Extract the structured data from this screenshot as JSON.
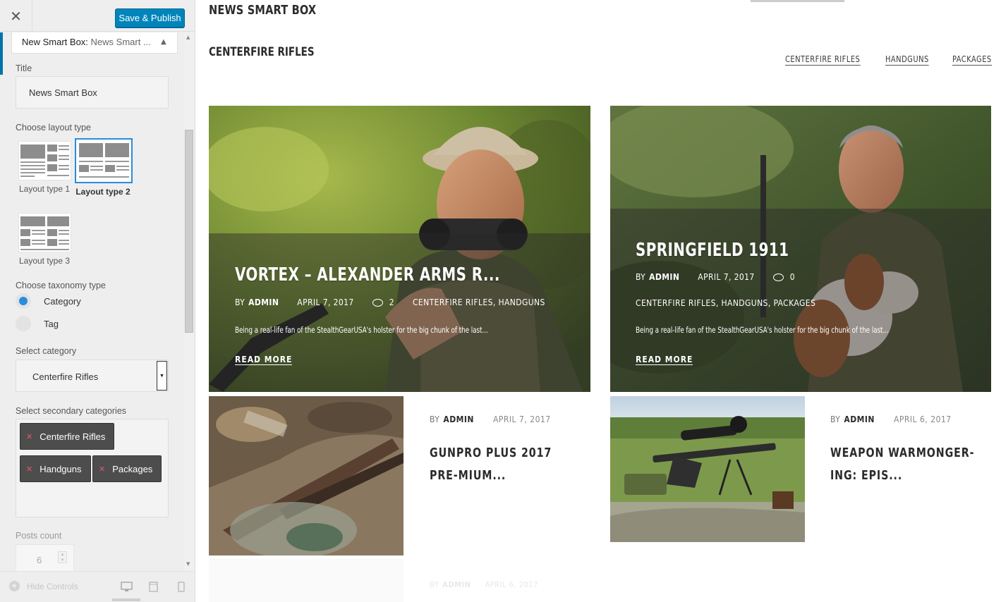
{
  "customizer": {
    "close_icon": "close-icon",
    "publish_label": "Save & Publish",
    "section": {
      "title_prefix": "New Smart Box:",
      "title_rest": " News Smart ..."
    },
    "title_field": {
      "label": "Title",
      "value": "News Smart Box"
    },
    "layout": {
      "label": "Choose layout type",
      "options": [
        {
          "label": "Layout type 1",
          "selected": false
        },
        {
          "label": "Layout type 2",
          "selected": true
        },
        {
          "label": "Layout type 3",
          "selected": false
        }
      ]
    },
    "taxonomy": {
      "label": "Choose taxonomy type",
      "options": [
        {
          "label": "Category",
          "checked": true
        },
        {
          "label": "Tag",
          "checked": false
        }
      ]
    },
    "category": {
      "label": "Select category",
      "value": "Centerfire Rifles"
    },
    "secondary": {
      "label": "Select secondary categories",
      "chips": [
        "Centerfire Rifles",
        "Handguns",
        "Packages"
      ]
    },
    "posts_count": {
      "label": "Posts count",
      "value": "6"
    },
    "footer": {
      "hide_label": "Hide Controls"
    },
    "accent_color": "#0085ba"
  },
  "preview": {
    "box_title": "NEWS SMART BOX",
    "category_heading": "CENTERFIRE RIFLES",
    "tabs": [
      "CENTERFIRE RIFLES",
      "HANDGUNS",
      "PACKAGES"
    ],
    "featured": [
      {
        "title": "VORTEX – ALEXANDER ARMS R...",
        "by": "BY",
        "author": "ADMIN",
        "date": "APRIL 7, 2017",
        "comments": "2",
        "categories": "CENTERFIRE RIFLES, HANDGUNS",
        "excerpt": "Being a real-life fan of the StealthGearUSA's holster for the big chunk of the last...",
        "read_more": "READ MORE"
      },
      {
        "title": "SPRINGFIELD 1911",
        "by": "BY",
        "author": "ADMIN",
        "date": "APRIL 7, 2017",
        "comments": "0",
        "categories": "CENTERFIRE RIFLES, HANDGUNS, PACKAGES",
        "excerpt": "Being a real-life fan of the StealthGearUSA's holster for the big chunk of the last...",
        "read_more": "READ MORE"
      }
    ],
    "small_posts": [
      {
        "by": "BY",
        "author": "ADMIN",
        "date": "APRIL 7, 2017",
        "title": "GUNPRO PLUS 2017 PRE-MIUM..."
      },
      {
        "by": "BY",
        "author": "ADMIN",
        "date": "APRIL 6, 2017",
        "title": "WEAPON WARMONGER-ING: EPIS..."
      }
    ],
    "faded_post": {
      "by": "BY",
      "author": "ADMIN",
      "date": "APRIL 6, 2017"
    }
  }
}
